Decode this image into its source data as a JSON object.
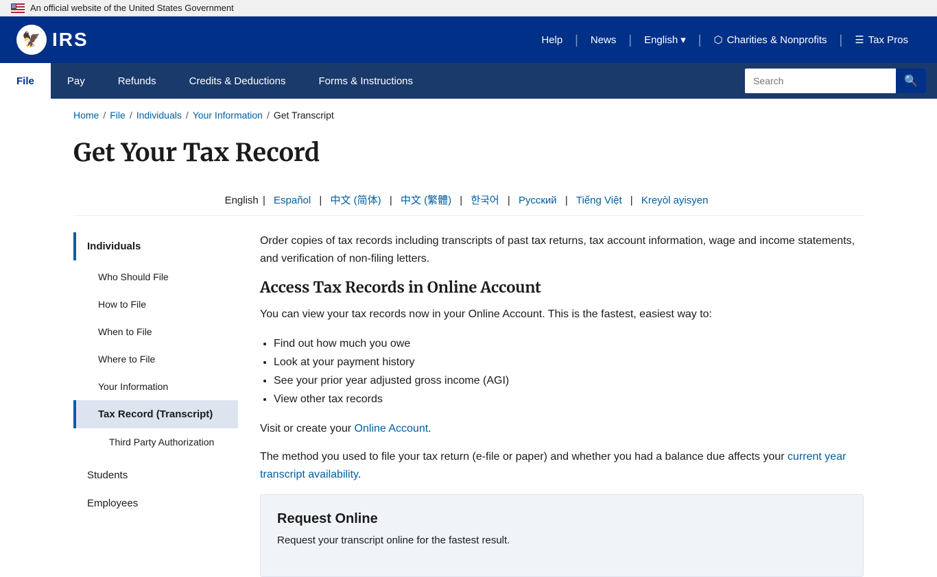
{
  "gov_banner": {
    "text": "An official website of the United States Government"
  },
  "header": {
    "logo_text": "IRS",
    "nav": {
      "help": "Help",
      "news": "News",
      "language": "English",
      "charities": "Charities & Nonprofits",
      "tax_pros": "Tax Pros"
    }
  },
  "main_nav": {
    "items": [
      {
        "label": "File",
        "active": true
      },
      {
        "label": "Pay",
        "active": false
      },
      {
        "label": "Refunds",
        "active": false
      },
      {
        "label": "Credits & Deductions",
        "active": false
      },
      {
        "label": "Forms & Instructions",
        "active": false
      }
    ],
    "search_placeholder": "Search"
  },
  "breadcrumb": {
    "items": [
      {
        "label": "Home",
        "link": true
      },
      {
        "label": "File",
        "link": true
      },
      {
        "label": "Individuals",
        "link": true
      },
      {
        "label": "Your Information",
        "link": true
      },
      {
        "label": "Get Transcript",
        "link": false
      }
    ]
  },
  "page_title": "Get Your Tax Record",
  "language_bar": {
    "current": "English",
    "links": [
      "Español",
      "中文 (简体)",
      "中文 (繁體)",
      "한국어",
      "Русский",
      "Tiếng Việt",
      "Kreyòl ayisyen"
    ]
  },
  "sidebar": {
    "sections": [
      {
        "label": "Individuals",
        "type": "parent",
        "children": [
          {
            "label": "Who Should File",
            "type": "child"
          },
          {
            "label": "How to File",
            "type": "child"
          },
          {
            "label": "When to File",
            "type": "child"
          },
          {
            "label": "Where to File",
            "type": "child"
          },
          {
            "label": "Your Information",
            "type": "child",
            "children": [
              {
                "label": "Tax Record (Transcript)",
                "type": "active-child"
              },
              {
                "label": "Third Party Authorization",
                "type": "child"
              }
            ]
          }
        ]
      },
      {
        "label": "Students",
        "type": "top"
      },
      {
        "label": "Employees",
        "type": "top"
      }
    ]
  },
  "main_content": {
    "intro": "Order copies of tax records including transcripts of past tax returns, tax account information, wage and income statements, and verification of non-filing letters.",
    "section1_title": "Access Tax Records in Online Account",
    "section1_intro": "You can view your tax records now in your Online Account. This is the fastest, easiest way to:",
    "section1_bullets": [
      "Find out how much you owe",
      "Look at your payment history",
      "See your prior year adjusted gross income (AGI)",
      "View other tax records"
    ],
    "section1_cta_prefix": "Visit or create your ",
    "section1_cta_link": "Online Account",
    "section1_cta_suffix": ".",
    "section1_note_prefix": "The method you used to file your tax return (e-file or paper) and whether you had a balance due affects  your ",
    "section1_note_link": "current year transcript availability",
    "section1_note_suffix": ".",
    "box_title": "Request Online",
    "box_text": "Request your transcript online for the fastest result."
  }
}
